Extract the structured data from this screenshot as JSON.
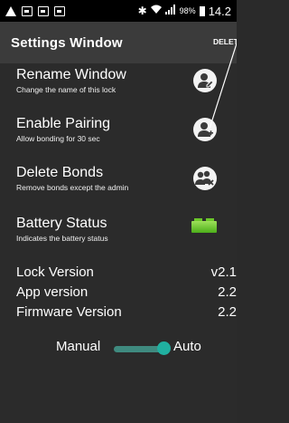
{
  "status_bar": {
    "battery_percent": "98%",
    "time": "14.2"
  },
  "toolbar": {
    "title": "Settings  Window",
    "delete_label": "DELETE"
  },
  "settings": [
    {
      "title": "Rename Window",
      "subtitle": "Change the name of this lock",
      "icon": "person-edit-icon"
    },
    {
      "title": "Enable Pairing",
      "subtitle": "Allow bonding for 30 sec",
      "icon": "person-add-icon"
    },
    {
      "title": "Delete Bonds",
      "subtitle": "Remove bonds except the admin",
      "icon": "person-remove-icon"
    },
    {
      "title": "Battery Status",
      "subtitle": "Indicates the battery status",
      "icon": "battery-full-icon",
      "battery_color": "#6bc72a"
    }
  ],
  "versions": [
    {
      "label": "Lock Version",
      "value": "v2.1"
    },
    {
      "label": "App version",
      "value": "2.2"
    },
    {
      "label": "Firmware Version",
      "value": "2.2"
    }
  ],
  "mode_toggle": {
    "left_label": "Manual",
    "right_label": "Auto",
    "selected": "Auto",
    "accent_color": "#20b0a0"
  }
}
